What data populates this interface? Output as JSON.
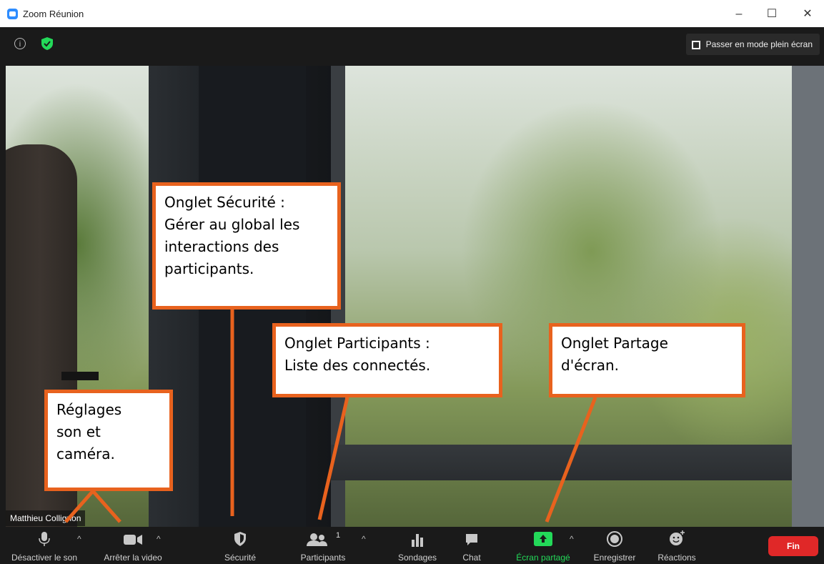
{
  "window": {
    "title": "Zoom Réunion",
    "minimize": "–",
    "maximize": "☐",
    "close": "✕"
  },
  "topbar": {
    "fullscreen_label": "Passer en mode plein écran"
  },
  "video": {
    "participant_name": "Matthieu Collignon"
  },
  "callouts": {
    "securite": [
      "Onglet Sécurité :",
      "Gérer au global les",
      "interactions des",
      "participants."
    ],
    "participants": [
      "Onglet Participants :",
      "Liste des connectés."
    ],
    "partage": [
      "Onglet Partage",
      "d'écran."
    ],
    "reglages": [
      "Réglages",
      "son et",
      "caméra."
    ]
  },
  "toolbar": {
    "mute_label": "Désactiver le son",
    "video_label": "Arrêter la video",
    "security_label": "Sécurité",
    "participants_label": "Participants",
    "participants_count": "1",
    "polls_label": "Sondages",
    "chat_label": "Chat",
    "share_label": "Écran partagé",
    "record_label": "Enregistrer",
    "reactions_label": "Réactions",
    "end_label": "Fin",
    "caret": "^"
  },
  "colors": {
    "accent_orange": "#e8621e",
    "share_green": "#23d959",
    "end_red": "#e02828",
    "zoom_blue": "#2d8cff"
  }
}
